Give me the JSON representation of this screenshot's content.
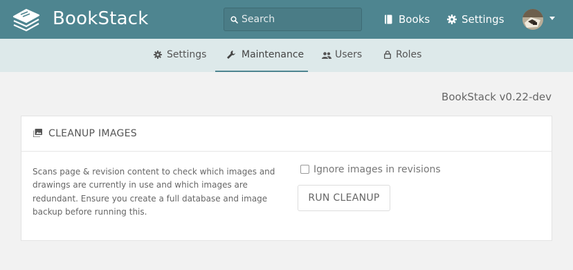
{
  "header": {
    "app_name": "BookStack",
    "search_placeholder": "Search",
    "nav": {
      "books": "Books",
      "settings": "Settings"
    },
    "brand_color": "#4e8590"
  },
  "tabs": {
    "settings": "Settings",
    "maintenance": "Maintenance",
    "users": "Users",
    "roles": "Roles",
    "active": "maintenance"
  },
  "version": "BookStack v0.22-dev",
  "cleanup": {
    "title": "CLEANUP IMAGES",
    "description": "Scans page & revision content to check which images and drawings are currently in use and which images are redundant. Ensure you create a full database and image backup before running this.",
    "checkbox_label": "Ignore images in revisions",
    "checkbox_checked": false,
    "button_label": "RUN CLEANUP"
  }
}
